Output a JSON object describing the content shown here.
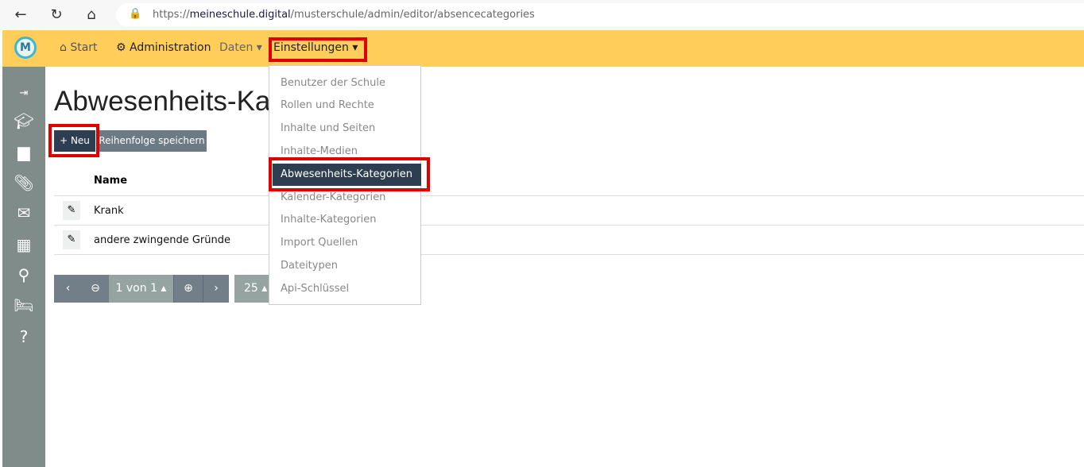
{
  "browser": {
    "url_prefix": "https://",
    "url_domain": "meineschule.digital",
    "url_path": "/musterschule/admin/editor/absencecategories"
  },
  "nav": {
    "logo": "M",
    "items": [
      {
        "label": "Start",
        "icon": "home-icon"
      },
      {
        "label": "Administration",
        "icon": "gear-icon"
      },
      {
        "label": "Daten ▾"
      },
      {
        "label": "Einstellungen ▾"
      }
    ]
  },
  "sidebar": {
    "icons": [
      "logout-icon",
      "graduation-cap-icon",
      "calendar-icon",
      "paperclip-icon",
      "envelope-icon",
      "calendar-days-icon",
      "teacher-icon",
      "bed-icon",
      "person-question-icon"
    ]
  },
  "page": {
    "title": "Abwesenheits-Kategorien",
    "new_button": "+ Neu",
    "save_order_button": "Reihenfolge speichern"
  },
  "table": {
    "header": "Name",
    "rows": [
      "Krank",
      "andere zwingende Gründe"
    ]
  },
  "pagination": {
    "page_label": "1 von 1 ▴",
    "page_size": "25 ▴"
  },
  "dropdown": {
    "items": [
      "Benutzer der Schule",
      "Rollen und Rechte",
      "Inhalte und Seiten",
      "Inhalte-Medien",
      "Abwesenheits-Kategorien",
      "Kalender-Kategorien",
      "Inhalte-Kategorien",
      "Import Quellen",
      "Dateitypen",
      "Api-Schlüssel"
    ],
    "active_index": 4
  },
  "colors": {
    "navbar": "#fecd5a",
    "sidebar": "#7f8c8a",
    "primary_dark": "#2c3e50",
    "highlight": "#e00000"
  }
}
